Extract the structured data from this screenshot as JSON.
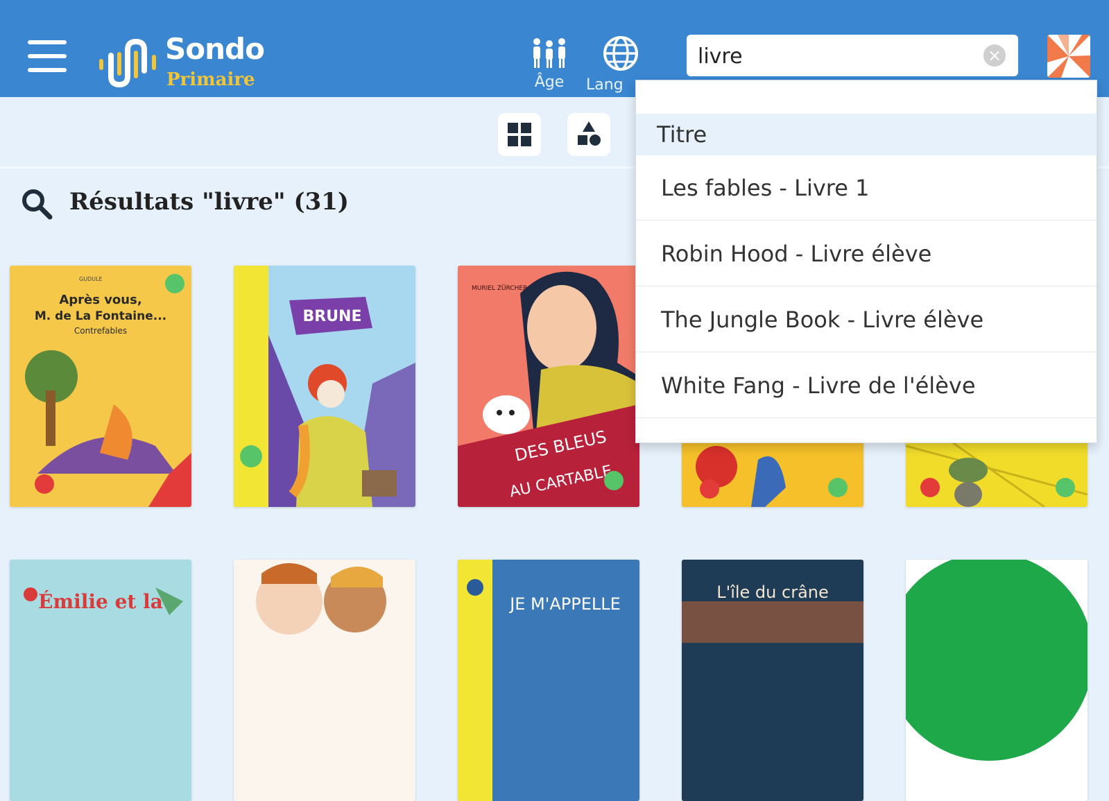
{
  "header": {
    "logo_title": "Sondo",
    "logo_subtitle": "Primaire",
    "age_label": "Âge",
    "lang_label": "Lang",
    "search": {
      "value": "livre",
      "placeholder": ""
    }
  },
  "results": {
    "title": "Résultats \"livre\"  (31)"
  },
  "autocomplete": {
    "section_title": "Titre",
    "items": [
      "Les fables - Livre 1",
      "Robin Hood - Livre élève",
      "The Jungle Book - Livre élève",
      "White Fang - Livre de l'élève"
    ]
  },
  "books": [
    {
      "cover_text": "Après vous, M. de La Fontaine...",
      "cover_sub": "Contrefables",
      "cover_author": "GUDULE"
    },
    {
      "cover_text": "BRUNE"
    },
    {
      "cover_text": "DES BLEUS AU CARTABLE",
      "cover_author": "MURIEL ZÜRCHER"
    },
    {
      "cover_text": ""
    },
    {
      "cover_text": ""
    },
    {
      "cover_text": "Émilie et la"
    },
    {
      "cover_text": ""
    },
    {
      "cover_text": "JE M'APPELLE"
    },
    {
      "cover_text": "L'île du crâne"
    },
    {
      "cover_text": ""
    }
  ],
  "colors": {
    "header_bg": "#3a86d1",
    "page_bg": "#e6f1fb",
    "logo_accent": "#f4c534"
  }
}
